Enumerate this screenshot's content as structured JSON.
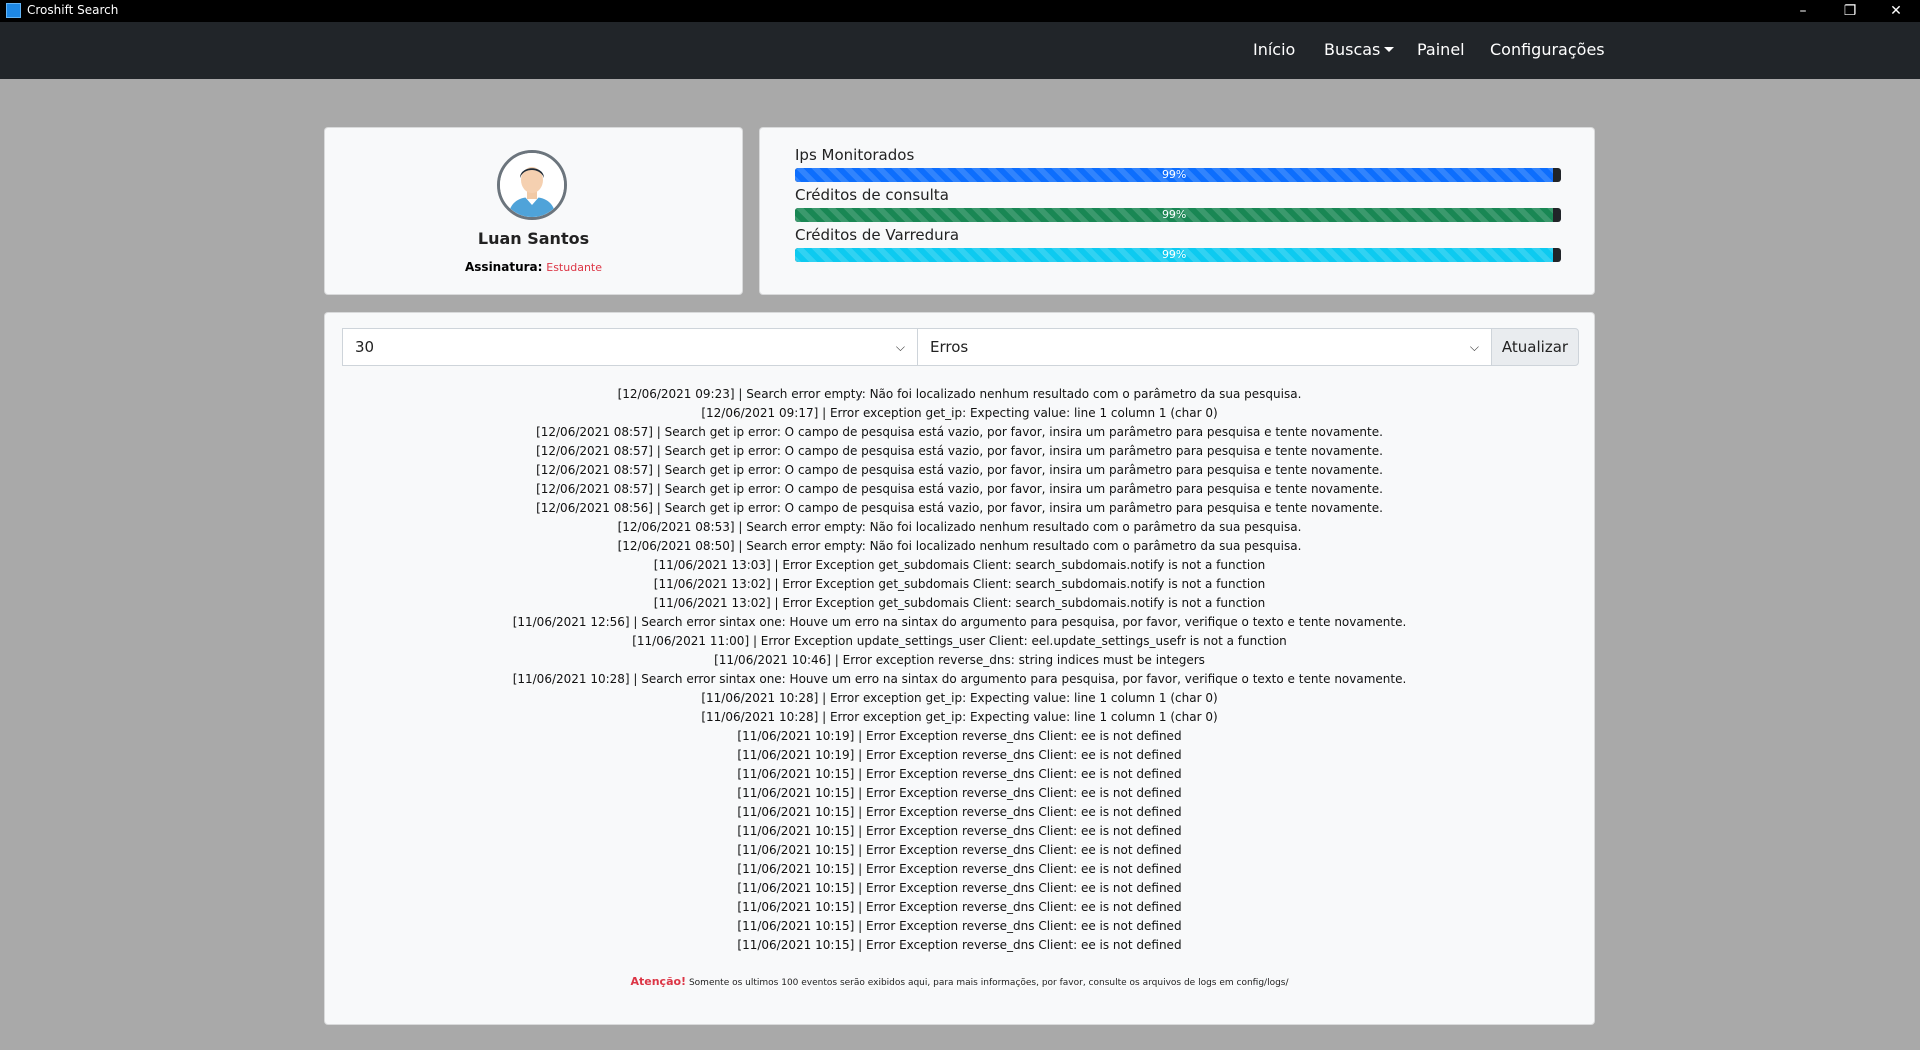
{
  "window": {
    "title": "Croshift Search",
    "controls": {
      "minimize": "–",
      "maximize": "❐",
      "close": "✕"
    }
  },
  "navbar": {
    "items": [
      {
        "label": "Início"
      },
      {
        "label": "Buscas",
        "dropdown": true
      },
      {
        "label": "Painel"
      },
      {
        "label": "Configurações"
      }
    ]
  },
  "profile": {
    "name": "Luan Santos",
    "subscription_label": "Assinatura:",
    "subscription_value": "Estudante",
    "avatar_icon": "user-avatar-icon"
  },
  "meters": [
    {
      "label": "Ips Monitorados",
      "percent_text": "99%",
      "value": 0.99,
      "color": "#0d6efd"
    },
    {
      "label": "Créditos de consulta",
      "percent_text": "99%",
      "value": 0.99,
      "color": "#198754"
    },
    {
      "label": "Créditos de Varredura",
      "percent_text": "99%",
      "value": 0.99,
      "color": "#0dcaf0"
    }
  ],
  "filters": {
    "count": "30",
    "type": "Erros",
    "refresh_label": "Atualizar"
  },
  "logs": [
    "[12/06/2021 09:23] | Search error empty: Não foi localizado nenhum resultado com o parâmetro da sua pesquisa.",
    "[12/06/2021 09:17] | Error exception get_ip: Expecting value: line 1 column 1 (char 0)",
    "[12/06/2021 08:57] | Search get ip error: O campo de pesquisa está vazio, por favor, insira um parâmetro para pesquisa e tente novamente.",
    "[12/06/2021 08:57] | Search get ip error: O campo de pesquisa está vazio, por favor, insira um parâmetro para pesquisa e tente novamente.",
    "[12/06/2021 08:57] | Search get ip error: O campo de pesquisa está vazio, por favor, insira um parâmetro para pesquisa e tente novamente.",
    "[12/06/2021 08:57] | Search get ip error: O campo de pesquisa está vazio, por favor, insira um parâmetro para pesquisa e tente novamente.",
    "[12/06/2021 08:56] | Search get ip error: O campo de pesquisa está vazio, por favor, insira um parâmetro para pesquisa e tente novamente.",
    "[12/06/2021 08:53] | Search error empty: Não foi localizado nenhum resultado com o parâmetro da sua pesquisa.",
    "[12/06/2021 08:50] | Search error empty: Não foi localizado nenhum resultado com o parâmetro da sua pesquisa.",
    "[11/06/2021 13:03] | Error Exception get_subdomais Client: search_subdomais.notify is not a function",
    "[11/06/2021 13:02] | Error Exception get_subdomais Client: search_subdomais.notify is not a function",
    "[11/06/2021 13:02] | Error Exception get_subdomais Client: search_subdomais.notify is not a function",
    "[11/06/2021 12:56] | Search error sintax one: Houve um erro na sintax do argumento para pesquisa, por favor, verifique o texto e tente novamente.",
    "[11/06/2021 11:00] | Error Exception update_settings_user Client: eel.update_settings_usefr is not a function",
    "[11/06/2021 10:46] | Error exception reverse_dns: string indices must be integers",
    "[11/06/2021 10:28] | Search error sintax one: Houve um erro na sintax do argumento para pesquisa, por favor, verifique o texto e tente novamente.",
    "[11/06/2021 10:28] | Error exception get_ip: Expecting value: line 1 column 1 (char 0)",
    "[11/06/2021 10:28] | Error exception get_ip: Expecting value: line 1 column 1 (char 0)",
    "[11/06/2021 10:19] | Error Exception reverse_dns Client: ee is not defined",
    "[11/06/2021 10:19] | Error Exception reverse_dns Client: ee is not defined",
    "[11/06/2021 10:15] | Error Exception reverse_dns Client: ee is not defined",
    "[11/06/2021 10:15] | Error Exception reverse_dns Client: ee is not defined",
    "[11/06/2021 10:15] | Error Exception reverse_dns Client: ee is not defined",
    "[11/06/2021 10:15] | Error Exception reverse_dns Client: ee is not defined",
    "[11/06/2021 10:15] | Error Exception reverse_dns Client: ee is not defined",
    "[11/06/2021 10:15] | Error Exception reverse_dns Client: ee is not defined",
    "[11/06/2021 10:15] | Error Exception reverse_dns Client: ee is not defined",
    "[11/06/2021 10:15] | Error Exception reverse_dns Client: ee is not defined",
    "[11/06/2021 10:15] | Error Exception reverse_dns Client: ee is not defined",
    "[11/06/2021 10:15] | Error Exception reverse_dns Client: ee is not defined"
  ],
  "notice": {
    "warning_label": "Atenção!",
    "text": "Somente os ultimos 100 eventos serão exibidos aqui, para mais informações, por favor, consulte os arquivos de logs em config/logs/"
  }
}
